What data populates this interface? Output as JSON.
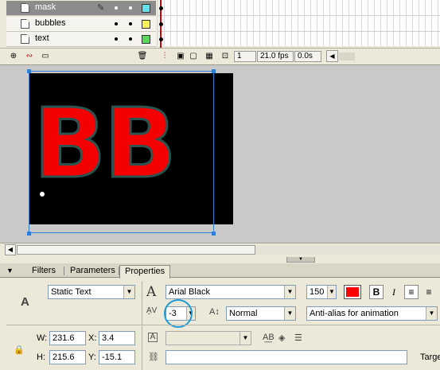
{
  "timeline": {
    "layers": [
      {
        "name": "mask",
        "selected": true,
        "color": "#66e0e8"
      },
      {
        "name": "bubbles",
        "selected": false,
        "color": "#f2f25a"
      },
      {
        "name": "text",
        "selected": false,
        "color": "#5bd85b"
      }
    ],
    "frame_number": "1",
    "fps": "21.0 fps",
    "elapsed": "0.0s"
  },
  "stage": {
    "text": "BB",
    "text_color": "#f40000",
    "stroke_color": "#2c5350",
    "background": "#000000"
  },
  "properties": {
    "tabs": [
      "Filters",
      "Parameters",
      "Properties"
    ],
    "active_tab": "Properties",
    "text_type": "Static Text",
    "font": "Arial Black",
    "font_size": "150",
    "fill_color": "#ff0000",
    "bold_label": "B",
    "italic_label": "I",
    "letter_spacing": "-3",
    "char_position": "Normal",
    "anti_alias": "Anti-alias for animation",
    "w_label": "W:",
    "w_value": "231.6",
    "x_label": "X:",
    "x_value": "3.4",
    "h_label": "H:",
    "h_value": "215.6",
    "y_label": "Y:",
    "y_value": "-15.1",
    "target_label": "Targe",
    "icon_A": "A",
    "icon_AV": "A̱V",
    "icon_Aa": "A↕"
  }
}
